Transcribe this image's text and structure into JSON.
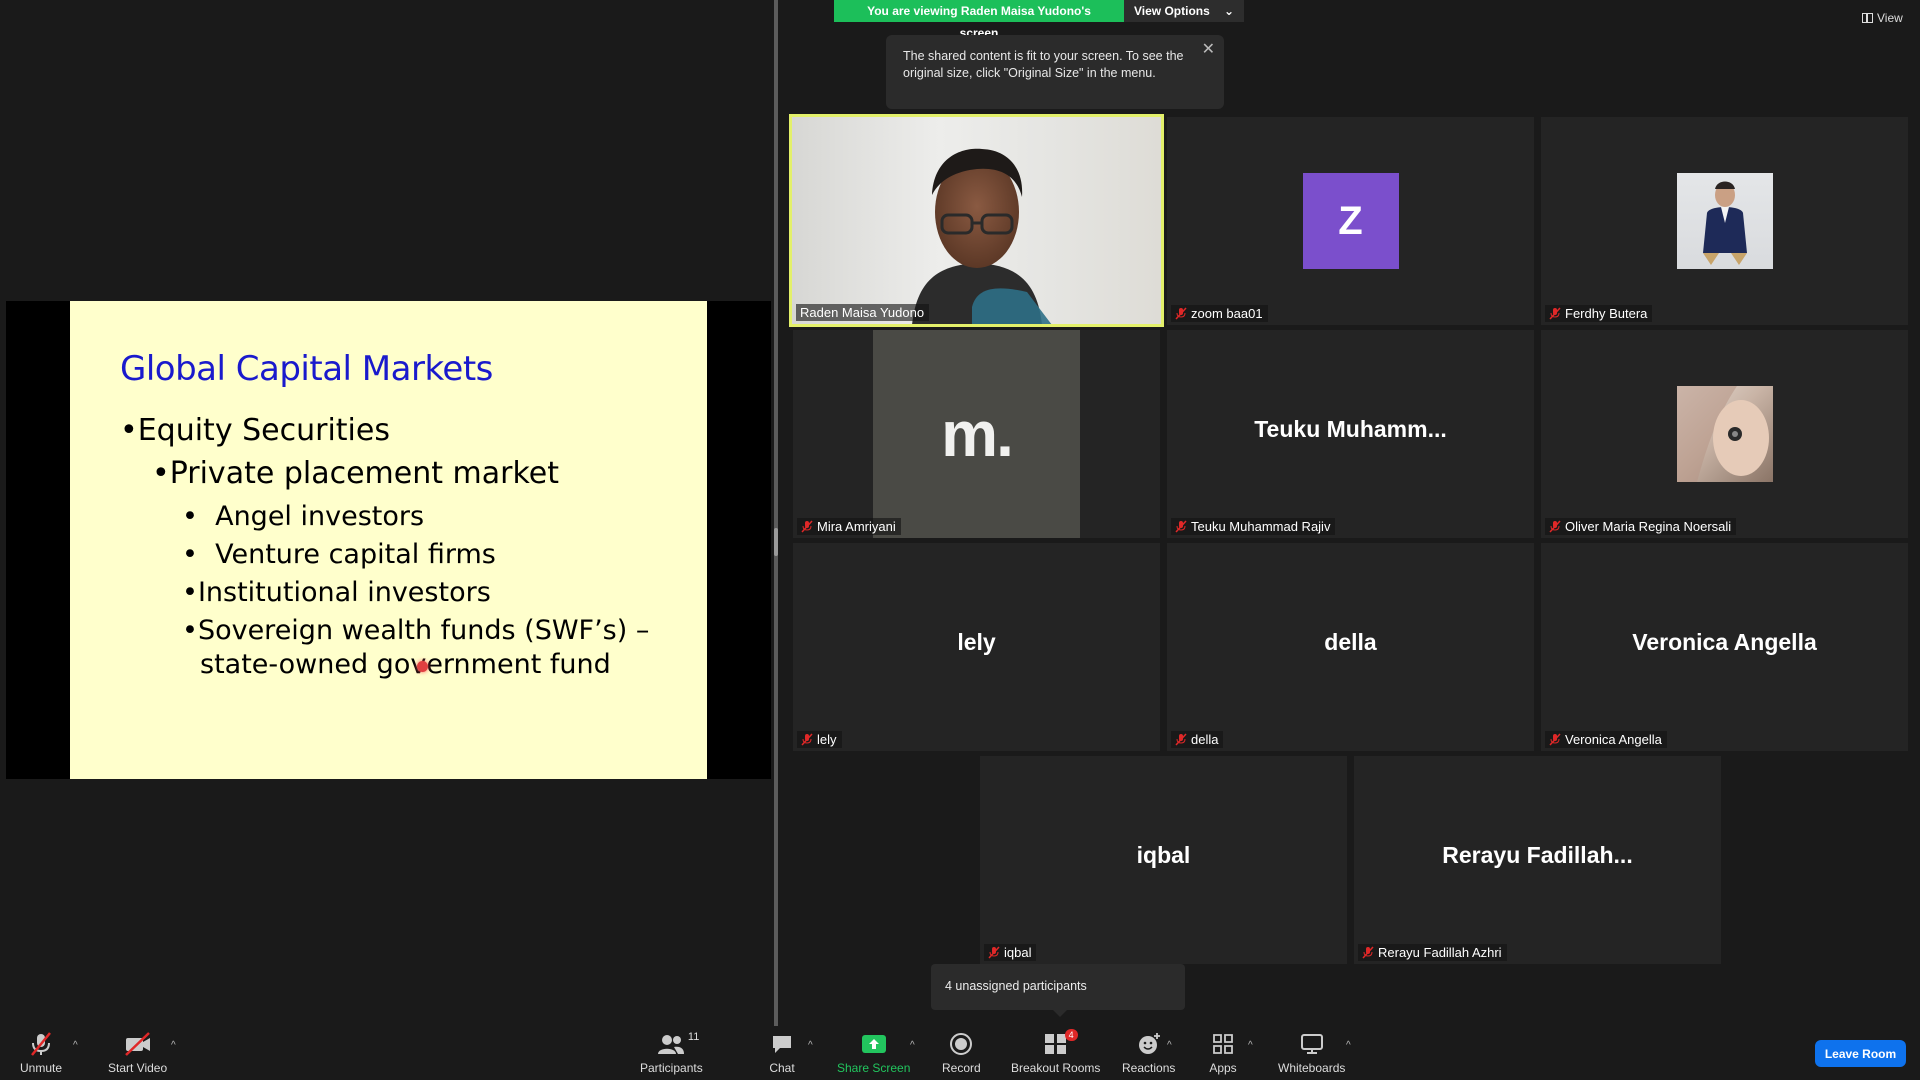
{
  "banner": {
    "viewing_text": "You are viewing Raden Maisa Yudono's screen",
    "view_options": "View Options"
  },
  "tooltip": {
    "text": "The shared content is fit to your screen. To see the original size, click \"Original Size\" in the menu."
  },
  "view_button": "View",
  "slide": {
    "title": "Global Capital Markets",
    "bullets": {
      "b1": "Equity Securities",
      "b2": "Private placement market",
      "b3a": "Angel investors",
      "b3b": "Venture capital firms",
      "b3c": "Institutional investors",
      "b3d": "Sovereign wealth funds (SWF’s) –",
      "b3e": "state-owned government fund"
    }
  },
  "participants_tiles": [
    {
      "name": "Raden Maisa Yudono"
    },
    {
      "name": "zoom baa01",
      "initial": "Z"
    },
    {
      "name": "Ferdhy Butera"
    },
    {
      "name": "Mira Amriyani"
    },
    {
      "name": "Teuku Muhammad Rajiv",
      "display": "Teuku  Muhamm..."
    },
    {
      "name": "Oliver Maria Regina Noersali"
    },
    {
      "name": "lely",
      "display": "lely"
    },
    {
      "name": "della",
      "display": "della"
    },
    {
      "name": "Veronica Angella",
      "display": "Veronica Angella"
    },
    {
      "name": "iqbal",
      "display": "iqbal"
    },
    {
      "name": "Rerayu Fadillah Azhri",
      "display": "Rerayu  Fadillah..."
    }
  ],
  "mira_logo_text": "m.",
  "popup": {
    "unassigned": "4 unassigned participants"
  },
  "toolbar": {
    "unmute": "Unmute",
    "start_video": "Start Video",
    "participants": "Participants",
    "participants_count": "11",
    "chat": "Chat",
    "share_screen": "Share Screen",
    "record": "Record",
    "breakout_rooms": "Breakout Rooms",
    "breakout_badge": "4",
    "reactions": "Reactions",
    "apps": "Apps",
    "whiteboards": "Whiteboards",
    "leave": "Leave Room"
  },
  "colors": {
    "accent_green": "#1cbf5a",
    "leave_blue": "#0e72ed",
    "active_border": "#e3f06a",
    "mute_red": "#e02828"
  }
}
